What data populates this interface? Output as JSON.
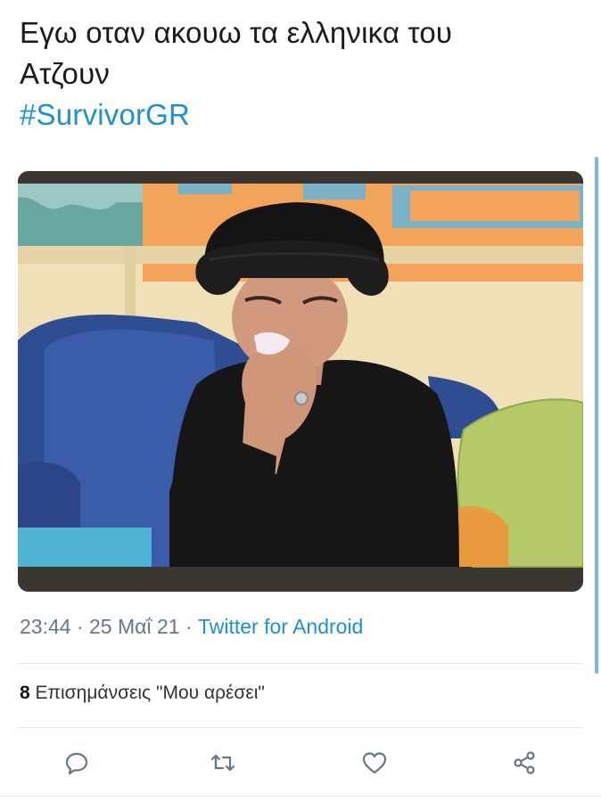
{
  "tweet": {
    "text_line1": "Εγω οταν ακουω τα ελληνικα του",
    "text_line2": "Ατζουν",
    "hashtag": "#SurvivorGR",
    "time": "23:44",
    "separator": " · ",
    "date": "25 Μαΐ 21",
    "source": "Twitter for Android",
    "likes_count": "8",
    "likes_label": " Επισημάνσεις \"Μου αρέσει\""
  },
  "actions": [
    {
      "name": "reply-button",
      "icon": "reply-icon"
    },
    {
      "name": "retweet-button",
      "icon": "retweet-icon"
    },
    {
      "name": "like-button",
      "icon": "heart-icon"
    },
    {
      "name": "share-button",
      "icon": "share-icon"
    }
  ],
  "colors": {
    "link": "#1d8fd6",
    "meta": "#657786",
    "icon": "#657786"
  }
}
